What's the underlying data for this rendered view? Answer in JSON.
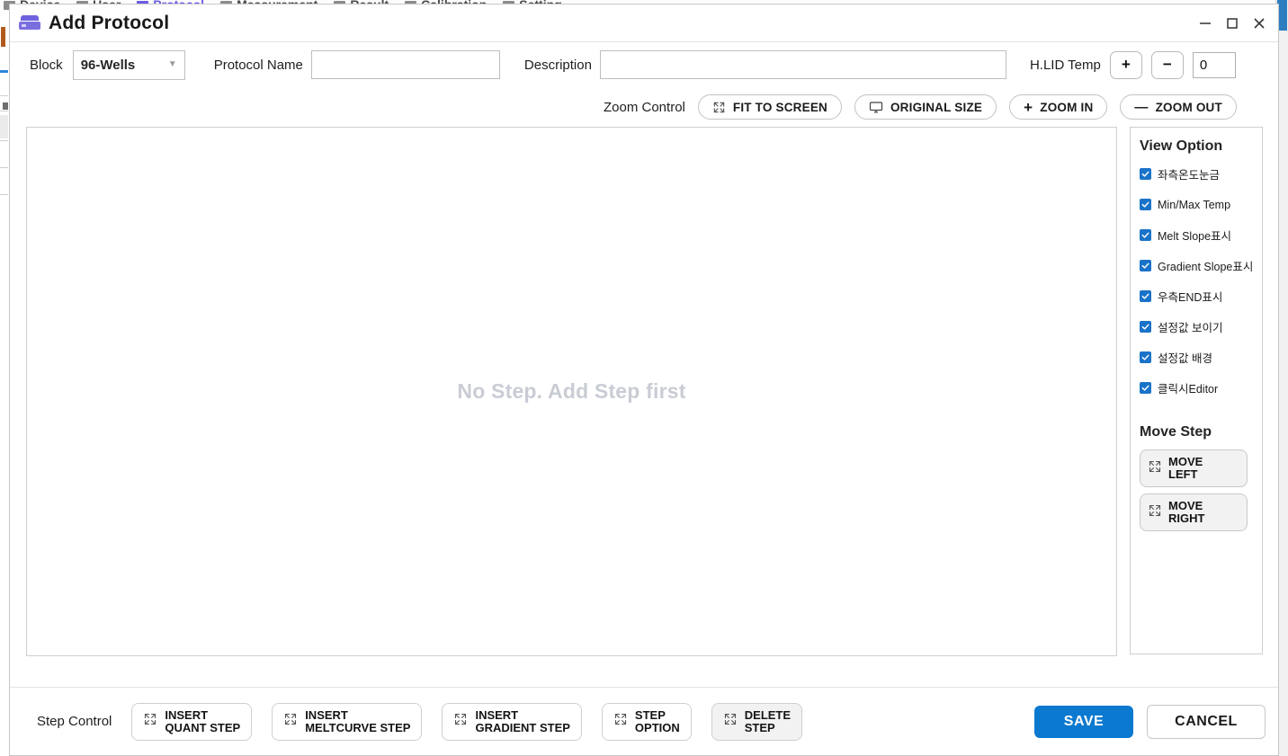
{
  "background": {
    "menu_items": [
      {
        "label": "Device"
      },
      {
        "label": "User"
      },
      {
        "label": "Protocol",
        "active": true
      },
      {
        "label": "Measurement"
      },
      {
        "label": "Result"
      },
      {
        "label": "Calibration"
      },
      {
        "label": "Setting"
      }
    ],
    "active_color": "#6b5ce7"
  },
  "window": {
    "title": "Add Protocol",
    "icon": "protocol-device-icon",
    "minimize": "minimize-icon",
    "maximize": "maximize-icon",
    "close": "close-icon"
  },
  "form": {
    "block_label": "Block",
    "block_value": "96-Wells",
    "protocol_name_label": "Protocol Name",
    "protocol_name_value": "",
    "protocol_name_placeholder": "",
    "description_label": "Description",
    "description_value": "",
    "description_placeholder": "",
    "hlid_label": "H.LID Temp",
    "hlid_plus": "+",
    "hlid_minus": "−",
    "hlid_value": "0"
  },
  "zoom_control": {
    "label": "Zoom Control",
    "buttons": [
      {
        "label": "FIT TO SCREEN",
        "icon": "expand-arrows-icon"
      },
      {
        "label": "ORIGINAL SIZE",
        "icon": "monitor-icon"
      },
      {
        "label": "ZOOM IN",
        "icon": "plus-icon"
      },
      {
        "label": "ZOOM OUT",
        "icon": "minus-icon"
      }
    ]
  },
  "canvas": {
    "empty_message": "No Step. Add Step first"
  },
  "view_option": {
    "title": "View Option",
    "items": [
      {
        "label": "좌측온도눈금",
        "checked": true
      },
      {
        "label": "Min/Max Temp",
        "checked": true
      },
      {
        "label": "Melt Slope표시",
        "checked": true
      },
      {
        "label": "Gradient Slope표시",
        "checked": true
      },
      {
        "label": "우측END표시",
        "checked": true
      },
      {
        "label": "설정값 보이기",
        "checked": true
      },
      {
        "label": "설정값 배경",
        "checked": true
      },
      {
        "label": "클릭시Editor",
        "checked": true
      }
    ]
  },
  "move_step": {
    "title": "Move Step",
    "buttons": [
      {
        "line1": "MOVE",
        "line2": "LEFT",
        "icon": "expand-arrows-icon"
      },
      {
        "line1": "MOVE",
        "line2": "RIGHT",
        "icon": "expand-arrows-icon"
      }
    ]
  },
  "step_control": {
    "label": "Step Control",
    "buttons": [
      {
        "line1": "INSERT",
        "line2": "QUANT STEP",
        "icon": "expand-arrows-icon",
        "dim": false
      },
      {
        "line1": "INSERT",
        "line2": "MELTCURVE STEP",
        "icon": "expand-arrows-icon",
        "dim": false
      },
      {
        "line1": "INSERT",
        "line2": "GRADIENT STEP",
        "icon": "expand-arrows-icon",
        "dim": false
      },
      {
        "line1": "STEP",
        "line2": "OPTION",
        "icon": "expand-arrows-icon",
        "dim": false
      },
      {
        "line1": "DELETE",
        "line2": "STEP",
        "icon": "expand-arrows-icon",
        "dim": true
      }
    ]
  },
  "actions": {
    "save_label": "SAVE",
    "cancel_label": "CANCEL",
    "save_color": "#0b79d0"
  }
}
